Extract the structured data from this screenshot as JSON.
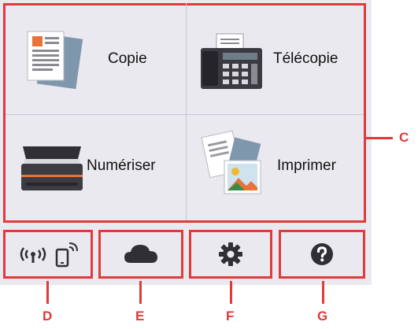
{
  "tiles": {
    "copy": {
      "label": "Copie",
      "icon": "document-copy-icon"
    },
    "fax": {
      "label": "Télécopie",
      "icon": "fax-machine-icon"
    },
    "scan": {
      "label": "Numériser",
      "icon": "scanner-icon"
    },
    "print": {
      "label": "Imprimer",
      "icon": "photo-print-icon"
    }
  },
  "bottom_bar": [
    {
      "id": "wireless",
      "icon": "wireless-direct-icon"
    },
    {
      "id": "cloud",
      "icon": "cloud-icon"
    },
    {
      "id": "settings",
      "icon": "gear-icon"
    },
    {
      "id": "help",
      "icon": "help-icon"
    }
  ],
  "callouts": {
    "main_area": "C",
    "wireless": "D",
    "cloud": "E",
    "settings": "F",
    "help": "G"
  },
  "colors": {
    "highlight": "#e03a3a",
    "screen_bg": "#eae9ef",
    "icon_dark": "#2f2f35"
  }
}
